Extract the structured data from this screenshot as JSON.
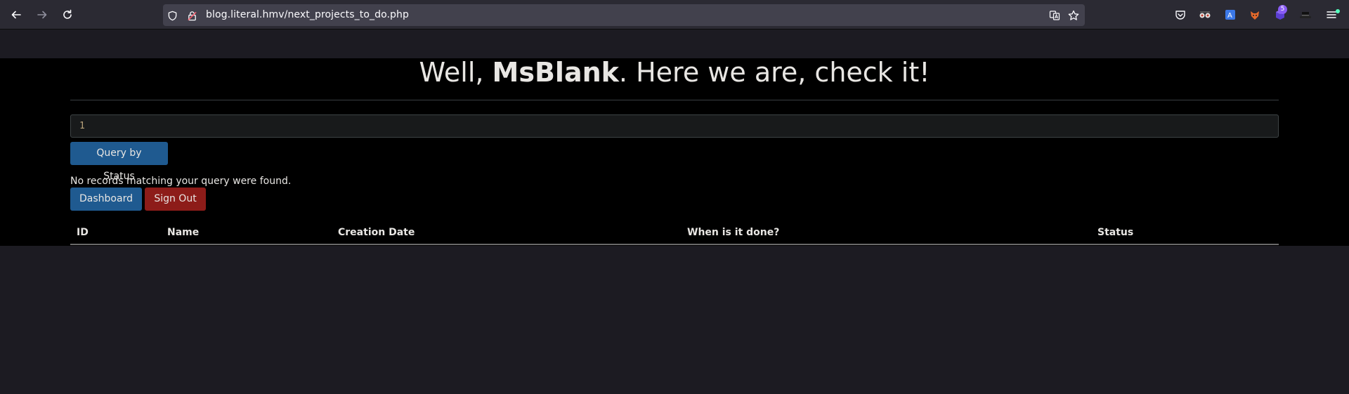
{
  "browser": {
    "url": "blog.literal.hmv/next_projects_to_do.php",
    "extension_badge": "5",
    "nav": {
      "back_icon": "back-arrow-icon",
      "forward_icon": "forward-arrow-icon",
      "reload_icon": "reload-icon"
    }
  },
  "page": {
    "heading_prefix": "Well, ",
    "heading_user": "MsBlank",
    "heading_suffix": ". Here we are, check it!",
    "query_value": "1",
    "query_button": "Query by Status",
    "no_records": "No records matching your query were found.",
    "dashboard_button": "Dashboard",
    "signout_button": "Sign Out",
    "table_headers": [
      "ID",
      "Name",
      "Creation Date",
      "When is it done?",
      "Status"
    ]
  },
  "colors": {
    "primary_button": "#1f5a90",
    "danger_button": "#8d1c19",
    "page_background": "#000000",
    "chrome_background": "#2b2a33"
  }
}
